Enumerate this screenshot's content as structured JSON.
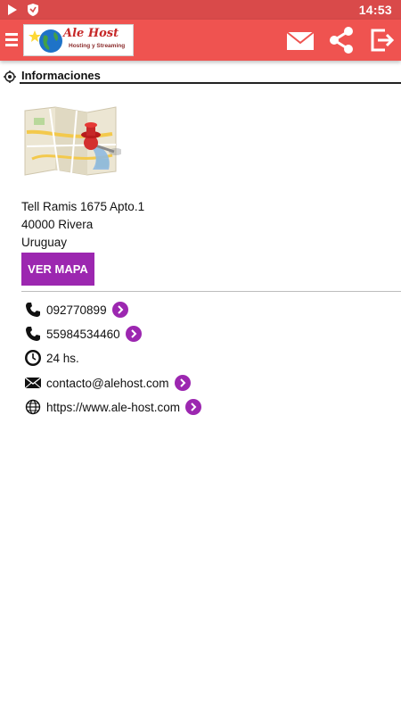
{
  "status_bar": {
    "time": "14:53"
  },
  "app_bar": {
    "logo_brand": "Ale Host",
    "logo_tagline": "Hosting y Streaming"
  },
  "section": {
    "title": "Informaciones"
  },
  "address": {
    "line1": "Tell Ramis 1675 Apto.1",
    "line2": "40000 Rivera",
    "line3": "Uruguay"
  },
  "buttons": {
    "view_map": "VER MAPA"
  },
  "contacts": [
    {
      "icon": "phone-icon",
      "text": "092770899",
      "action": true
    },
    {
      "icon": "phone-icon",
      "text": "55984534460",
      "action": true
    },
    {
      "icon": "clock-icon",
      "text": "24 hs.",
      "action": false
    },
    {
      "icon": "mail-icon",
      "text": "contacto@alehost.com",
      "action": true
    },
    {
      "icon": "globe-icon",
      "text": "https://www.ale-host.com",
      "action": true
    }
  ],
  "colors": {
    "status_bar": "#d94a4a",
    "app_bar": "#ef5350",
    "accent": "#9c27b0"
  }
}
